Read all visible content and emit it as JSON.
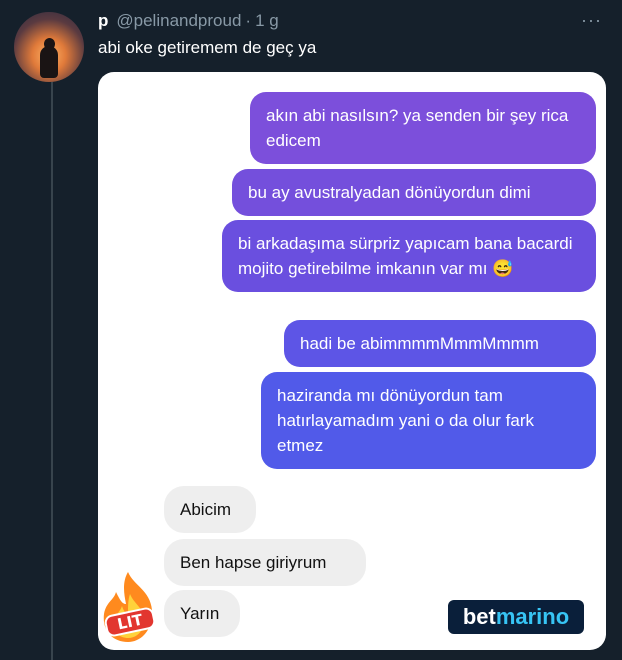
{
  "tweet": {
    "display_name": "p",
    "handle": "@pelinandproud",
    "separator": "·",
    "time": "1 g",
    "more_icon": "···",
    "text": "abi oke getiremem de geç ya"
  },
  "chat": {
    "outgoing": [
      "akın abi nasılsın? ya senden bir şey rica edicem",
      "bu ay avustralyadan dönüyordun dimi",
      "bi arkadaşıma sürpriz yapıcam bana bacardi mojito getirebilme imkanın var mı",
      "hadi be abimmmmMmmMmmm",
      "haziranda mı dönüyordun tam hatırlayamadım yani o da olur fark etmez"
    ],
    "emoji": "😅",
    "incoming": [
      "Abicim",
      "Ben hapse giriyrum",
      "Yarın"
    ]
  },
  "sticker": {
    "text": "LIT"
  },
  "watermark": {
    "part1": "bet",
    "part2": "marino"
  },
  "colors": {
    "background": "#15202b",
    "bubble_top": "#7a50dc",
    "bubble_bottom": "#4f5bea",
    "incoming_bubble": "#eeeeee",
    "watermark_bg": "#0a1f3a",
    "watermark_accent": "#37c4f4"
  }
}
